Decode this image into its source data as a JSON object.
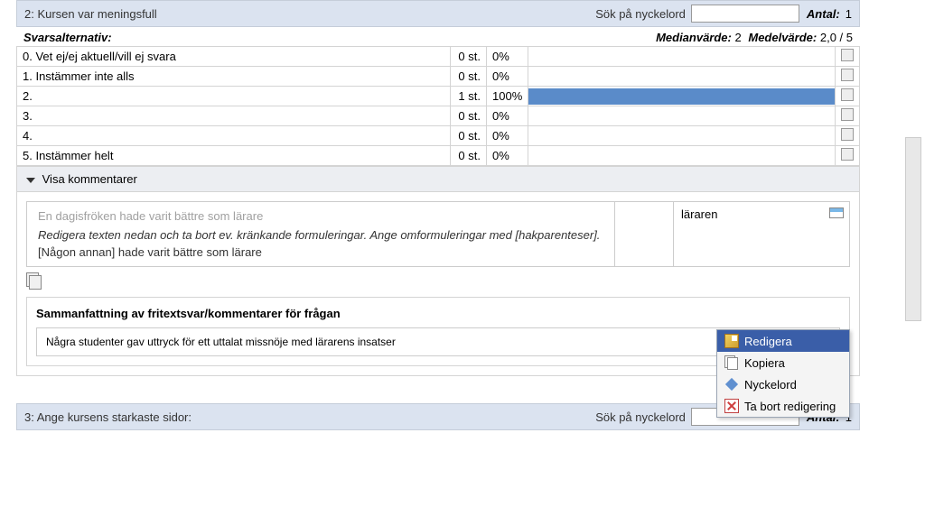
{
  "question2": {
    "title": "2: Kursen var meningsfull",
    "search_label": "Sök på nyckelord",
    "antal_label": "Antal:",
    "antal_value": "1",
    "svars_label": "Svarsalternativ:",
    "median_label": "Medianvärde:",
    "median_value": "2",
    "medel_label": "Medelvärde:",
    "medel_value": "2,0 / 5",
    "rows": [
      {
        "label": "0. Vet ej/ej aktuell/vill ej svara",
        "count": "0 st.",
        "pct": "0%",
        "bar": 0
      },
      {
        "label": "1. Instämmer inte alls",
        "count": "0 st.",
        "pct": "0%",
        "bar": 0
      },
      {
        "label": "2.",
        "count": "1 st.",
        "pct": "100%",
        "bar": 100
      },
      {
        "label": "3.",
        "count": "0 st.",
        "pct": "0%",
        "bar": 0
      },
      {
        "label": "4.",
        "count": "0 st.",
        "pct": "0%",
        "bar": 0
      },
      {
        "label": "5. Instämmer helt",
        "count": "0 st.",
        "pct": "0%",
        "bar": 0
      }
    ],
    "comments_toggle": "Visa kommentarer",
    "comment_orig": "En dagisfröken hade varit bättre som lärare",
    "comment_instr": "Redigera texten nedan och ta bort ev. kränkande formuleringar. Ange omformuleringar med [hakparenteser].",
    "comment_edited": "[Någon annan] hade varit bättre som lärare",
    "keyword": "läraren",
    "summary_title": "Sammanfattning av fritextsvar/kommentarer för frågan",
    "summary_text": "Några studenter gav uttryck för ett uttalat missnöje med lärarens insatser"
  },
  "question3": {
    "title": "3: Ange kursens starkaste sidor:",
    "search_label": "Sök på nyckelord",
    "antal_label": "Antal:",
    "antal_value": "1"
  },
  "menu": {
    "edit": "Redigera",
    "copy": "Kopiera",
    "keyword": "Nyckelord",
    "delete": "Ta bort redigering"
  },
  "chart_data": {
    "type": "bar",
    "title": "2: Kursen var meningsfull",
    "categories": [
      "0. Vet ej/ej aktuell/vill ej svara",
      "1. Instämmer inte alls",
      "2.",
      "3.",
      "4.",
      "5. Instämmer helt"
    ],
    "values": [
      0,
      0,
      1,
      0,
      0,
      0
    ],
    "percentages": [
      0,
      0,
      100,
      0,
      0,
      0
    ],
    "xlabel": "",
    "ylabel": "Antal",
    "median": 2,
    "mean": 2.0,
    "scale_max": 5,
    "n": 1
  }
}
